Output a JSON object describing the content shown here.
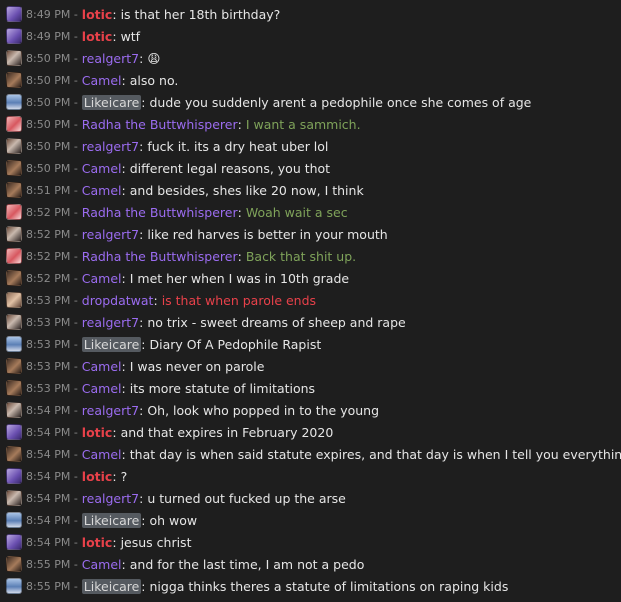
{
  "users": {
    "lotic": {
      "name": "lotic",
      "color": "#e8414a",
      "style": "strong",
      "avatar": "purple-avatar-icon"
    },
    "realgert7": {
      "name": "realgert7",
      "color": "#9b6cf0",
      "style": "normal",
      "avatar": "brown-avatar-icon"
    },
    "Camel": {
      "name": "Camel",
      "color": "#9b6cf0",
      "style": "normal",
      "avatar": "camel-avatar-icon"
    },
    "Likeicare": {
      "name": "Likeicare",
      "color": "#d8d8d8",
      "style": "boxed",
      "avatar": "blue-avatar-icon"
    },
    "Radha": {
      "name": "Radha the Buttwhisperer",
      "color": "#9b6cf0",
      "style": "normal",
      "avatar": "pink-avatar-icon"
    },
    "dropdatwat": {
      "name": "dropdatwat",
      "color": "#9b6cf0",
      "style": "normal",
      "avatar": "face-avatar-icon"
    }
  },
  "messages": [
    {
      "time": "8:49 PM -",
      "user": "lotic",
      "text": "is that her 18th birthday?",
      "text_color": "#e6e6e6"
    },
    {
      "time": "8:49 PM -",
      "user": "lotic",
      "text": "wtf",
      "text_color": "#e6e6e6"
    },
    {
      "time": "8:50 PM -",
      "user": "realgert7",
      "text": "😩",
      "text_color": "#e6e6e6"
    },
    {
      "time": "8:50 PM -",
      "user": "Camel",
      "text": "also no.",
      "text_color": "#e6e6e6"
    },
    {
      "time": "8:50 PM -",
      "user": "Likeicare",
      "text": "dude you suddenly arent a pedophile once she comes of age",
      "text_color": "#e6e6e6"
    },
    {
      "time": "8:50 PM -",
      "user": "Radha",
      "text": "I want a sammich.",
      "text_color": "#7fa35a"
    },
    {
      "time": "8:50 PM -",
      "user": "realgert7",
      "text": "fuck it. its a dry heat uber lol",
      "text_color": "#e6e6e6"
    },
    {
      "time": "8:50 PM -",
      "user": "Camel",
      "text": "different legal reasons, you thot",
      "text_color": "#e6e6e6"
    },
    {
      "time": "8:51 PM -",
      "user": "Camel",
      "text": "and besides, shes like 20 now, I think",
      "text_color": "#e6e6e6"
    },
    {
      "time": "8:52 PM -",
      "user": "Radha",
      "text": "Woah wait a sec",
      "text_color": "#7fa35a"
    },
    {
      "time": "8:52 PM -",
      "user": "realgert7",
      "text": "like red harves is better in your mouth",
      "text_color": "#e6e6e6"
    },
    {
      "time": "8:52 PM -",
      "user": "Radha",
      "text": "Back that shit up.",
      "text_color": "#7fa35a"
    },
    {
      "time": "8:52 PM -",
      "user": "Camel",
      "text": "I met her when I was in 10th grade",
      "text_color": "#e6e6e6"
    },
    {
      "time": "8:53 PM -",
      "user": "dropdatwat",
      "text": "is that when parole ends",
      "text_color": "#e8414a"
    },
    {
      "time": "8:53 PM -",
      "user": "realgert7",
      "text": "no trix - sweet dreams of sheep and rape",
      "text_color": "#e6e6e6"
    },
    {
      "time": "8:53 PM -",
      "user": "Likeicare",
      "text": "Diary Of A Pedophile Rapist",
      "text_color": "#e6e6e6"
    },
    {
      "time": "8:53 PM -",
      "user": "Camel",
      "text": "I was never on parole",
      "text_color": "#e6e6e6"
    },
    {
      "time": "8:53 PM -",
      "user": "Camel",
      "text": "its more statute of limitations",
      "text_color": "#e6e6e6"
    },
    {
      "time": "8:54 PM -",
      "user": "realgert7",
      "text": "Oh, look who popped in to the young",
      "text_color": "#e6e6e6"
    },
    {
      "time": "8:54 PM -",
      "user": "lotic",
      "text": "and that expires in February 2020",
      "text_color": "#e6e6e6"
    },
    {
      "time": "8:54 PM -",
      "user": "Camel",
      "text": "that day is when said statute expires, and that day is when I tell you everything",
      "text_color": "#e6e6e6"
    },
    {
      "time": "8:54 PM -",
      "user": "lotic",
      "text": "?",
      "text_color": "#e6e6e6"
    },
    {
      "time": "8:54 PM -",
      "user": "realgert7",
      "text": "u turned out fucked up the arse",
      "text_color": "#e6e6e6"
    },
    {
      "time": "8:54 PM -",
      "user": "Likeicare",
      "text": "oh wow",
      "text_color": "#e6e6e6"
    },
    {
      "time": "8:54 PM -",
      "user": "lotic",
      "text": "jesus christ",
      "text_color": "#e6e6e6"
    },
    {
      "time": "8:55 PM -",
      "user": "Camel",
      "text": "and for the last time, I am not a pedo",
      "text_color": "#e6e6e6"
    },
    {
      "time": "8:55 PM -",
      "user": "Likeicare",
      "text": "nigga thinks theres a statute of limitations on raping kids",
      "text_color": "#e6e6e6"
    }
  ]
}
